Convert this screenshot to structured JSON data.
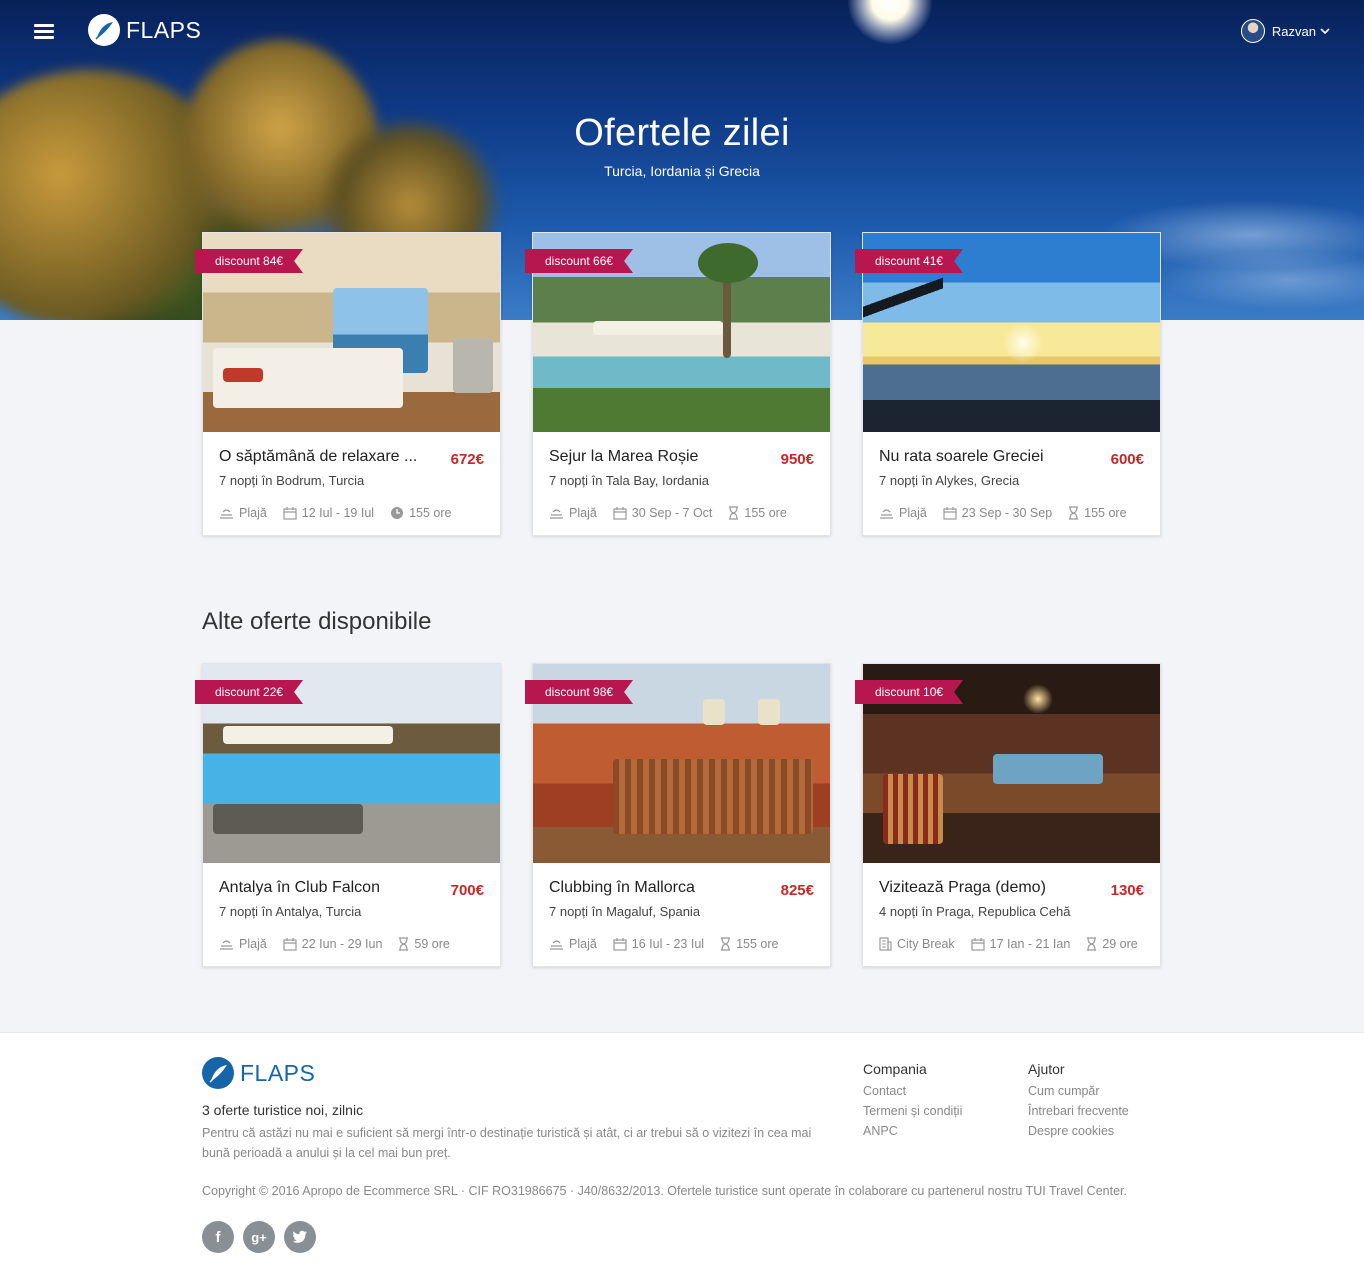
{
  "header": {
    "brand": "FLAPS",
    "user_name": "Razvan",
    "menu_icon": "hamburger-icon"
  },
  "hero": {
    "title": "Ofertele zilei",
    "subtitle": "Turcia, Iordania și Grecia"
  },
  "daily_offers": [
    {
      "discount": "discount 84€",
      "title": "O săptămână de relaxare ...",
      "price": "672€",
      "location": "7 nopți în Bodrum, Turcia",
      "type": "Plajă",
      "dates": "12 Iul - 19 Iul",
      "duration": "155 ore",
      "duration_icon": "clock-icon"
    },
    {
      "discount": "discount 66€",
      "title": "Sejur la Marea Roșie",
      "price": "950€",
      "location": "7 nopți în Tala Bay, Iordania",
      "type": "Plajă",
      "dates": "30 Sep - 7 Oct",
      "duration": "155 ore",
      "duration_icon": "hourglass-icon"
    },
    {
      "discount": "discount 41€",
      "title": "Nu rata soarele Greciei",
      "price": "600€",
      "location": "7 nopți în Alykes, Grecia",
      "type": "Plajă",
      "dates": "23 Sep - 30 Sep",
      "duration": "155 ore",
      "duration_icon": "hourglass-icon"
    }
  ],
  "other_section_title": "Alte oferte disponibile",
  "other_offers": [
    {
      "discount": "discount 22€",
      "title": "Antalya în Club Falcon",
      "price": "700€",
      "location": "7 nopți în Antalya, Turcia",
      "type": "Plajă",
      "dates": "22 Iun - 29 Iun",
      "duration": "59 ore",
      "duration_icon": "hourglass-icon"
    },
    {
      "discount": "discount 98€",
      "title": "Clubbing în Mallorca",
      "price": "825€",
      "location": "7 nopți în Magaluf, Spania",
      "type": "Plajă",
      "dates": "16 Iul - 23 Iul",
      "duration": "155 ore",
      "duration_icon": "hourglass-icon"
    },
    {
      "discount": "discount 10€",
      "title": "Vizitează Praga (demo)",
      "price": "130€",
      "location": "4 nopți în Praga, Republica Cehă",
      "type": "City Break",
      "dates": "17 Ian - 21 Ian",
      "duration": "29 ore",
      "duration_icon": "hourglass-icon"
    }
  ],
  "footer": {
    "brand": "FLAPS",
    "tagline": "3 oferte turistice noi, zilnic",
    "description": "Pentru că astăzi nu mai e suficient să mergi într-o destinație turistică și atât, ci ar trebui să o vizitezi în cea mai bună perioadă a anului și la cel mai bun preț.",
    "company": {
      "title": "Compania",
      "links": [
        "Contact",
        "Termeni și condiții",
        "ANPC"
      ]
    },
    "help": {
      "title": "Ajutor",
      "links": [
        "Cum cumpăr",
        "Întrebari frecvente",
        "Despre cookies"
      ]
    },
    "copyright": "Copyright © 2016 Apropo de Ecommerce SRL · CIF RO31986675 · J40/8632/2013. Ofertele turistice sunt operate în colaborare cu partenerul nostru TUI Travel Center.",
    "social": [
      {
        "name": "facebook-icon",
        "glyph": "f"
      },
      {
        "name": "google-plus-icon",
        "glyph": "g+"
      },
      {
        "name": "twitter-icon",
        "glyph": "t"
      }
    ]
  },
  "colors": {
    "accent": "#b8164f",
    "price": "#c62828",
    "brand_blue": "#1565a8"
  }
}
